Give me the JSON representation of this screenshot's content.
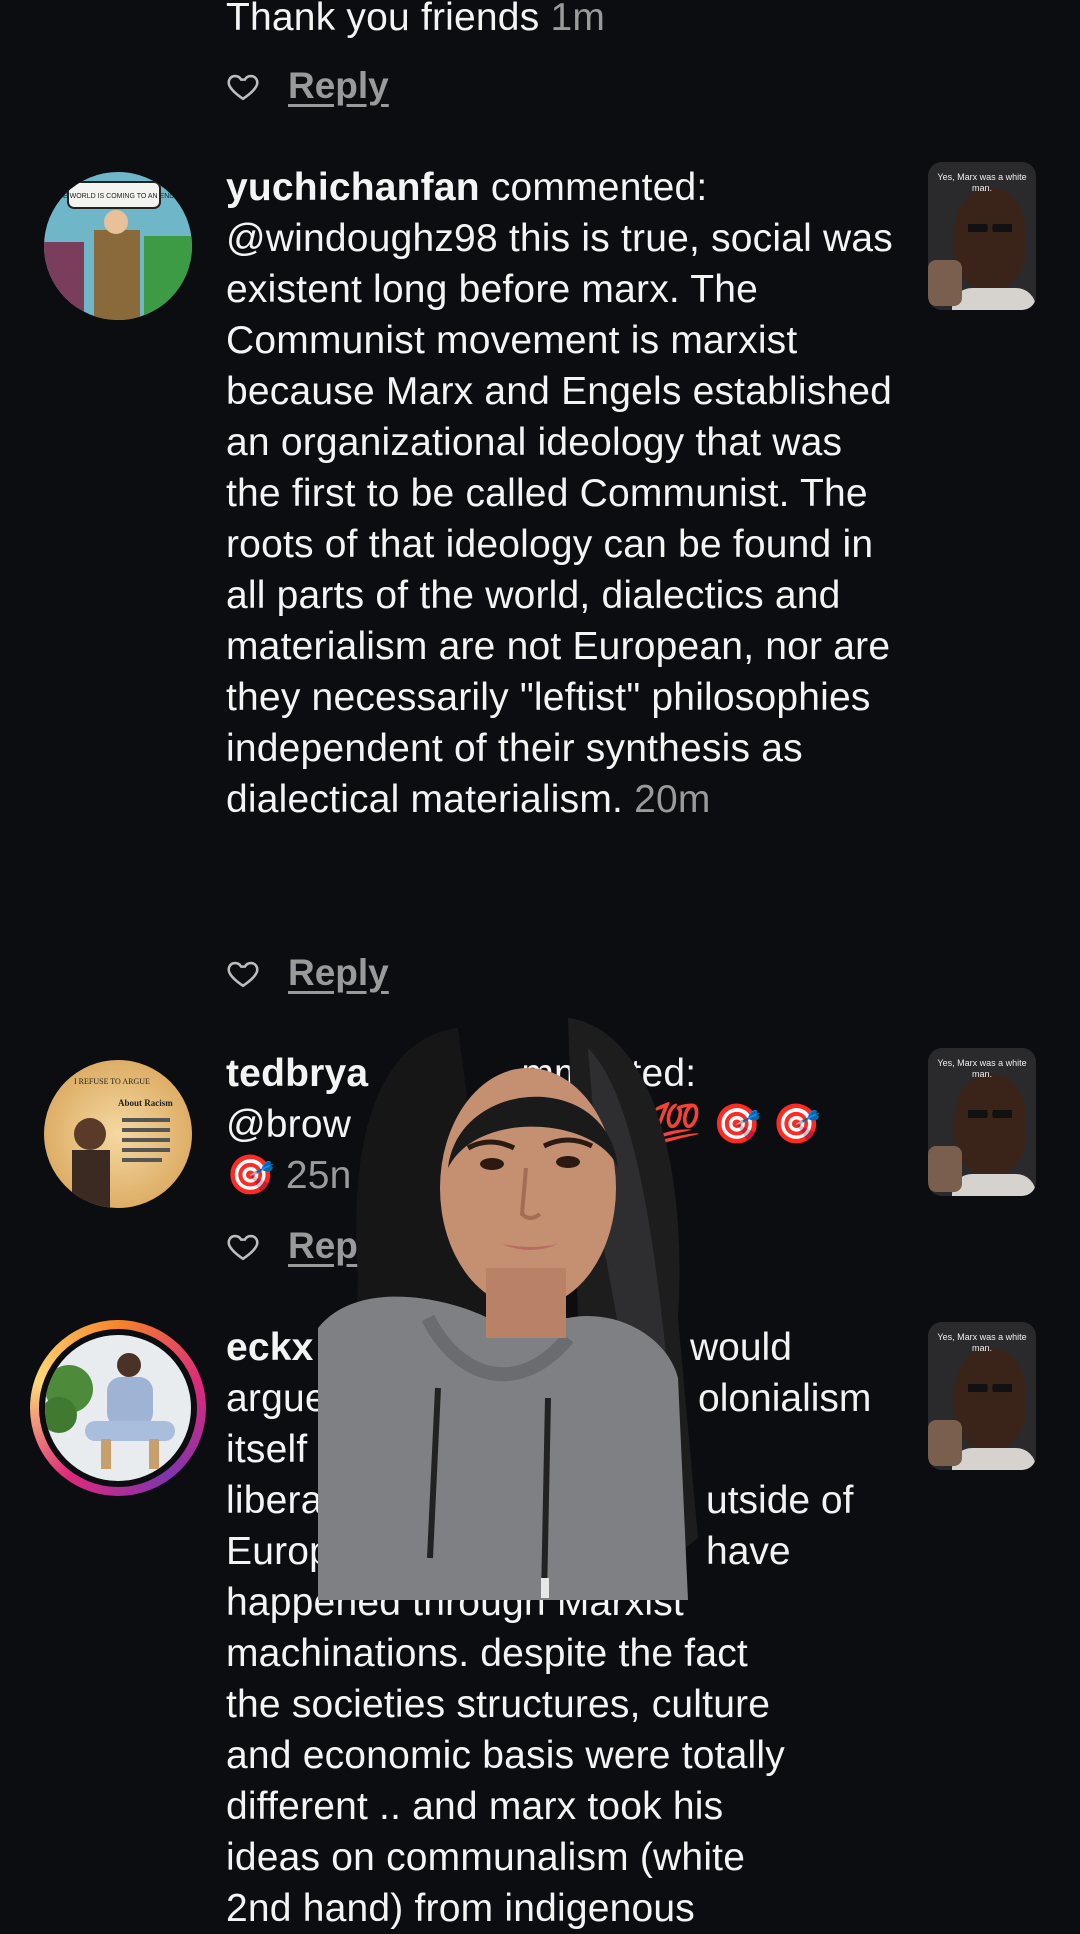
{
  "comments": [
    {
      "text_tail": "Thank you friends",
      "time": "1m",
      "reply_label": "Reply"
    },
    {
      "username": "yuchichanfan",
      "verb": "commented:",
      "body": "@windoughz98 this is true, social was existent long before marx. The Communist movement is marxist because Marx and Engels established an organizational ideology that was the first to be called Communist. The roots of that ideology can be found in all parts of the world, dialectics and materialism are not European, nor are they necessarily \"leftist\" philosophies independent of their synthesis as dialectical materialism.",
      "time": "20m",
      "reply_label": "Reply",
      "avatar_caption": "THE WORLD IS COMING TO AN END",
      "thumb_caption": "Yes, Marx was a white man."
    },
    {
      "username": "tedbrya",
      "verb": "mmented:",
      "body": "@brow",
      "emojis": "💯 💯 💯 🎯 🎯",
      "emoji_tail": "🎯",
      "time": "25n",
      "reply_label": "Repl",
      "avatar_caption_top": "I REFUSE TO ARGUE",
      "avatar_caption_bottom": "About Racism",
      "thumb_caption": "Yes, Marx was a white man."
    },
    {
      "lines": [
        "eckx",
        "argue",
        "itself",
        "libera",
        "Europ",
        "happened through Marxist",
        "machinations. despite the fact",
        "the societies structures, culture",
        "and economic basis were totally",
        "different .. and marx took his",
        "ideas on communalism (white",
        "2nd hand) from indigenous"
      ],
      "right_fragments": [
        "would",
        "olonialism",
        "utside of",
        "have"
      ],
      "thumb_caption": "Yes, Marx was a white man."
    }
  ],
  "colors": {
    "background": "#0b0d10",
    "text": "#f4f4f4",
    "muted": "#9a9a9a",
    "story_ring": [
      "#f58529",
      "#dd2a7b",
      "#8134af"
    ]
  },
  "icons": {
    "like": "heart-outline-icon"
  }
}
